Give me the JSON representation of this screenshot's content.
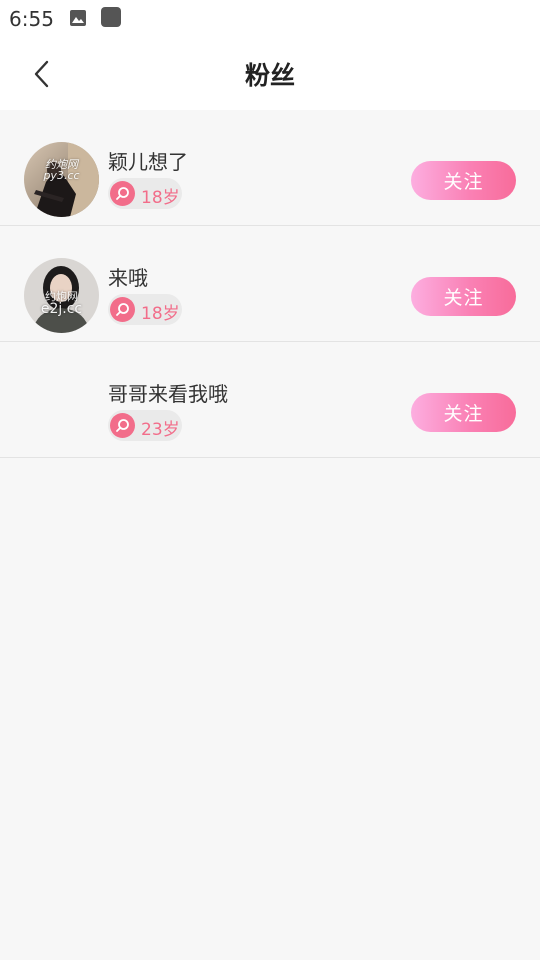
{
  "status_bar": {
    "time": "6:55",
    "icons": [
      "image-icon",
      "app-square-icon"
    ]
  },
  "header": {
    "back_icon": "chevron-left-icon",
    "title": "粉丝"
  },
  "fans": [
    {
      "name": "颖儿想了",
      "age": "18岁",
      "gender_icon": "female-icon",
      "avatar_watermark": [
        "约炮网",
        "py3.cc"
      ],
      "follow_label": "关注"
    },
    {
      "name": "来哦",
      "age": "18岁",
      "gender_icon": "female-icon",
      "avatar_watermark": [
        "约炮网",
        "e2j.cc"
      ],
      "follow_label": "关注"
    },
    {
      "name": "哥哥来看我哦",
      "age": "23岁",
      "gender_icon": "female-icon",
      "follow_label": "关注"
    }
  ],
  "colors": {
    "accent_pink": "#f26d8a",
    "follow_gradient_start": "#fcaee0",
    "follow_gradient_end": "#f86c9a",
    "background": "#f7f7f7"
  }
}
